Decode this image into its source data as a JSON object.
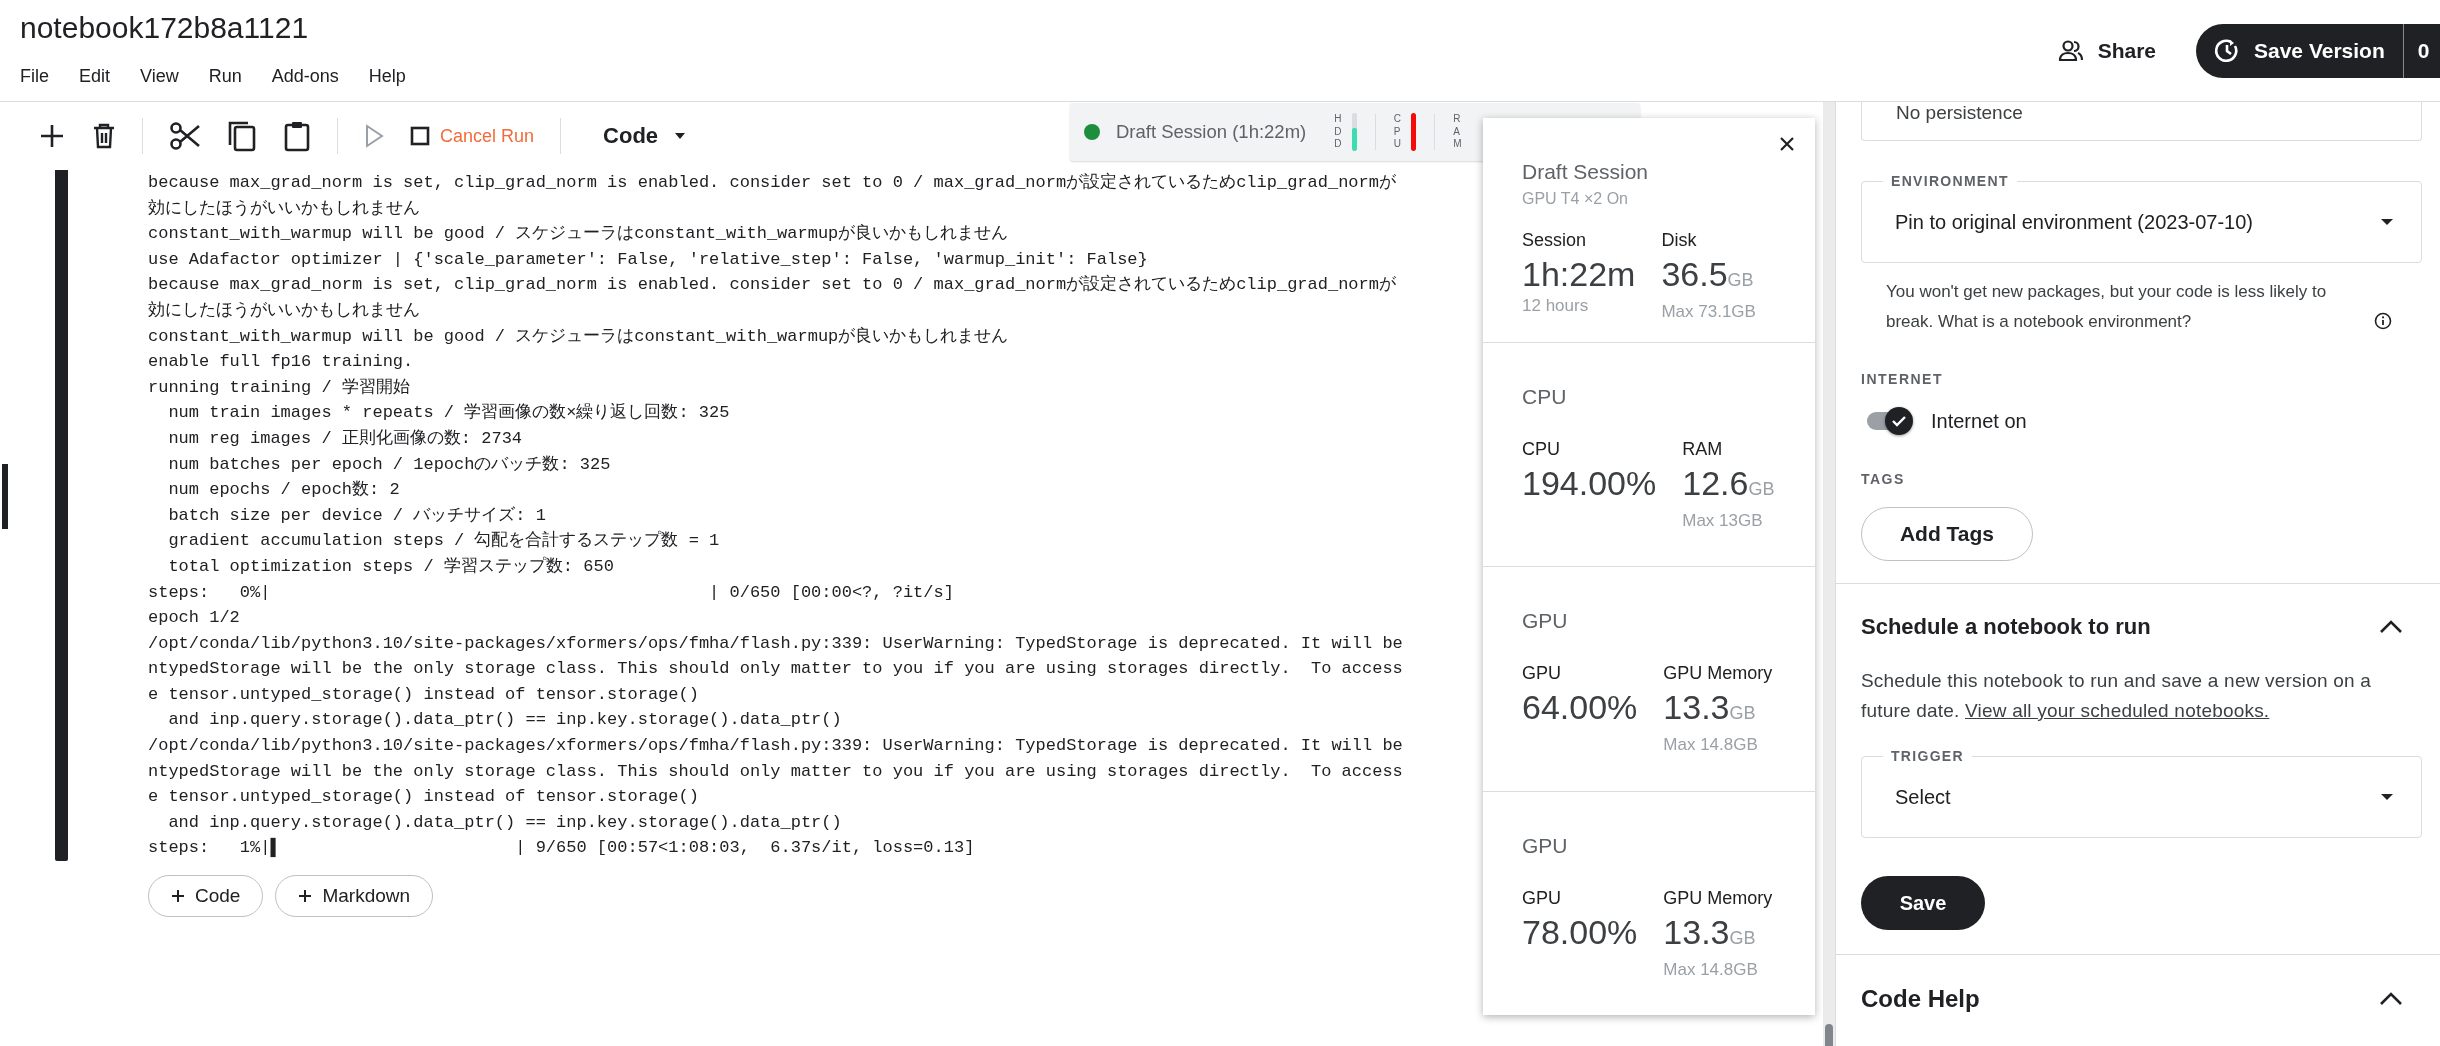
{
  "notebook": {
    "title": "notebook172b8a1121"
  },
  "menu": [
    "File",
    "Edit",
    "View",
    "Run",
    "Add-ons",
    "Help"
  ],
  "header_actions": {
    "share": "Share",
    "save_version": "Save Version",
    "version_count": "0"
  },
  "toolbar": {
    "cancel": "Cancel Run",
    "cell_type": "Code"
  },
  "session_bar": {
    "label": "Draft Session (1h:22m)",
    "meters": [
      {
        "label": "HDD",
        "level": 0.6,
        "color": "#3ddcb1"
      },
      {
        "label": "CPU",
        "level": 1.0,
        "color": "#f50a0a"
      },
      {
        "label": "RAM"
      }
    ]
  },
  "output_lines": [
    "because max_grad_norm is set, clip_grad_norm is enabled. consider set to 0 / max_grad_normが設定されているためclip_grad_normが",
    "効にしたほうがいいかもしれません",
    "constant_with_warmup will be good / スケジューラはconstant_with_warmupが良いかもしれません",
    "use Adafactor optimizer | {'scale_parameter': False, 'relative_step': False, 'warmup_init': False}",
    "because max_grad_norm is set, clip_grad_norm is enabled. consider set to 0 / max_grad_normが設定されているためclip_grad_normが",
    "効にしたほうがいいかもしれません",
    "constant_with_warmup will be good / スケジューラはconstant_with_warmupが良いかもしれません",
    "enable full fp16 training.",
    "running training / 学習開始",
    "  num train images * repeats / 学習画像の数×繰り返し回数: 325",
    "  num reg images / 正則化画像の数: 2734",
    "  num batches per epoch / 1epochのバッチ数: 325",
    "  num epochs / epoch数: 2",
    "  batch size per device / バッチサイズ: 1",
    "  gradient accumulation steps / 勾配を合計するステップ数 = 1",
    "  total optimization steps / 学習ステップ数: 650",
    "steps:   0%|                                           | 0/650 [00:00<?, ?it/s]",
    "epoch 1/2",
    "/opt/conda/lib/python3.10/site-packages/xformers/ops/fmha/flash.py:339: UserWarning: TypedStorage is deprecated. It will be",
    "ntypedStorage will be the only storage class. This should only matter to you if you are using storages directly.  To access",
    "e tensor.untyped_storage() instead of tensor.storage()",
    "  and inp.query.storage().data_ptr() == inp.key.storage().data_ptr()",
    "/opt/conda/lib/python3.10/site-packages/xformers/ops/fmha/flash.py:339: UserWarning: TypedStorage is deprecated. It will be",
    "ntypedStorage will be the only storage class. This should only matter to you if you are using storages directly.  To access",
    "e tensor.untyped_storage() instead of tensor.storage()",
    "  and inp.query.storage().data_ptr() == inp.key.storage().data_ptr()",
    "steps:   1%|▌                       | 9/650 [00:57<1:08:03,  6.37s/it, loss=0.13]"
  ],
  "add_cell_buttons": [
    "Code",
    "Markdown"
  ],
  "session_popup": {
    "title": "Draft Session",
    "subtitle": "GPU T4 ×2 On",
    "sections": [
      {
        "stats": [
          {
            "label": "Session",
            "value": "1h:22m",
            "note": "12 hours"
          },
          {
            "label": "Disk",
            "value": "36.5",
            "unit": "GB",
            "note": "Max 73.1GB"
          }
        ]
      },
      {
        "heading": "CPU",
        "stats": [
          {
            "label": "CPU",
            "value": "194.00%"
          },
          {
            "label": "RAM",
            "value": "12.6",
            "unit": "GB",
            "note": "Max 13GB"
          }
        ]
      },
      {
        "heading": "GPU",
        "stats": [
          {
            "label": "GPU",
            "value": "64.00%"
          },
          {
            "label": "GPU Memory",
            "value": "13.3",
            "unit": "GB",
            "note": "Max 14.8GB"
          }
        ]
      },
      {
        "heading": "GPU",
        "stats": [
          {
            "label": "GPU",
            "value": "78.00%"
          },
          {
            "label": "GPU Memory",
            "value": "13.3",
            "unit": "GB",
            "note": "Max 14.8GB"
          }
        ]
      }
    ]
  },
  "sidebar": {
    "persistence": {
      "value": "No persistence"
    },
    "environment": {
      "label": "ENVIRONMENT",
      "value": "Pin to original environment (2023-07-10)",
      "help": "You won't get new packages, but your code is less likely to break. What is a notebook environment?"
    },
    "internet": {
      "label": "INTERNET",
      "toggle_label": "Internet on",
      "on": true
    },
    "tags": {
      "label": "TAGS",
      "button": "Add Tags"
    },
    "schedule": {
      "title": "Schedule a notebook to run",
      "expanded": true,
      "text": "Schedule this notebook to run and save a new version on a future date.",
      "link": "View all your scheduled notebooks.",
      "trigger_label": "TRIGGER",
      "trigger_value": "Select",
      "save": "Save"
    },
    "code_help": {
      "title": "Code Help",
      "expanded": true
    }
  }
}
